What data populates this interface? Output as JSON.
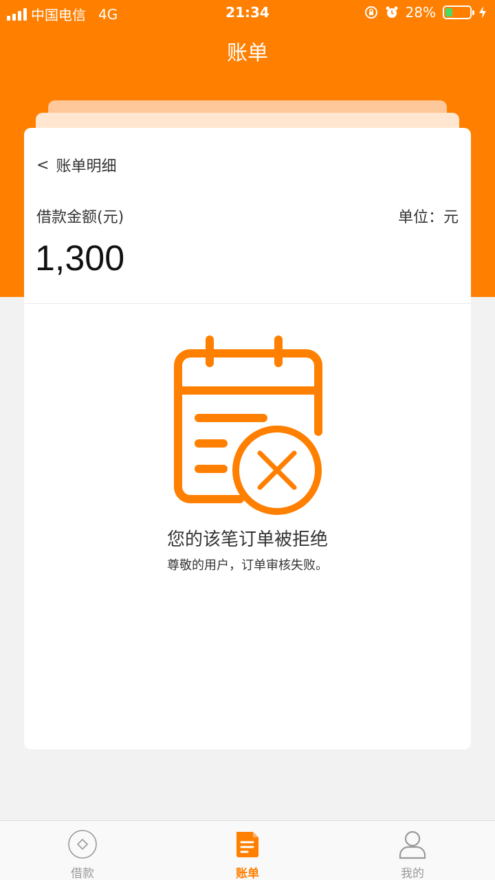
{
  "status_bar": {
    "carrier": "中国电信",
    "network": "4G",
    "time": "21:34",
    "battery_percent": "28%",
    "battery_level": 0.28
  },
  "header": {
    "title": "账单"
  },
  "card": {
    "back_label": "<",
    "title": "账单明细",
    "amount_label": "借款金额(元)",
    "unit_label": "单位：元",
    "amount_value": "1,300",
    "reject_icon": "calendar-reject-icon",
    "reject_title": "您的该笔订单被拒绝",
    "reject_subtitle": "尊敬的用户，订单审核失败。"
  },
  "tabs": [
    {
      "label": "借款",
      "icon": "diamond-circle-icon",
      "active": false
    },
    {
      "label": "账单",
      "icon": "document-icon",
      "active": true
    },
    {
      "label": "我的",
      "icon": "user-icon",
      "active": false
    }
  ],
  "colors": {
    "accent": "#ff7f00",
    "background": "#f2f2f2",
    "tab_inactive": "#999999"
  }
}
